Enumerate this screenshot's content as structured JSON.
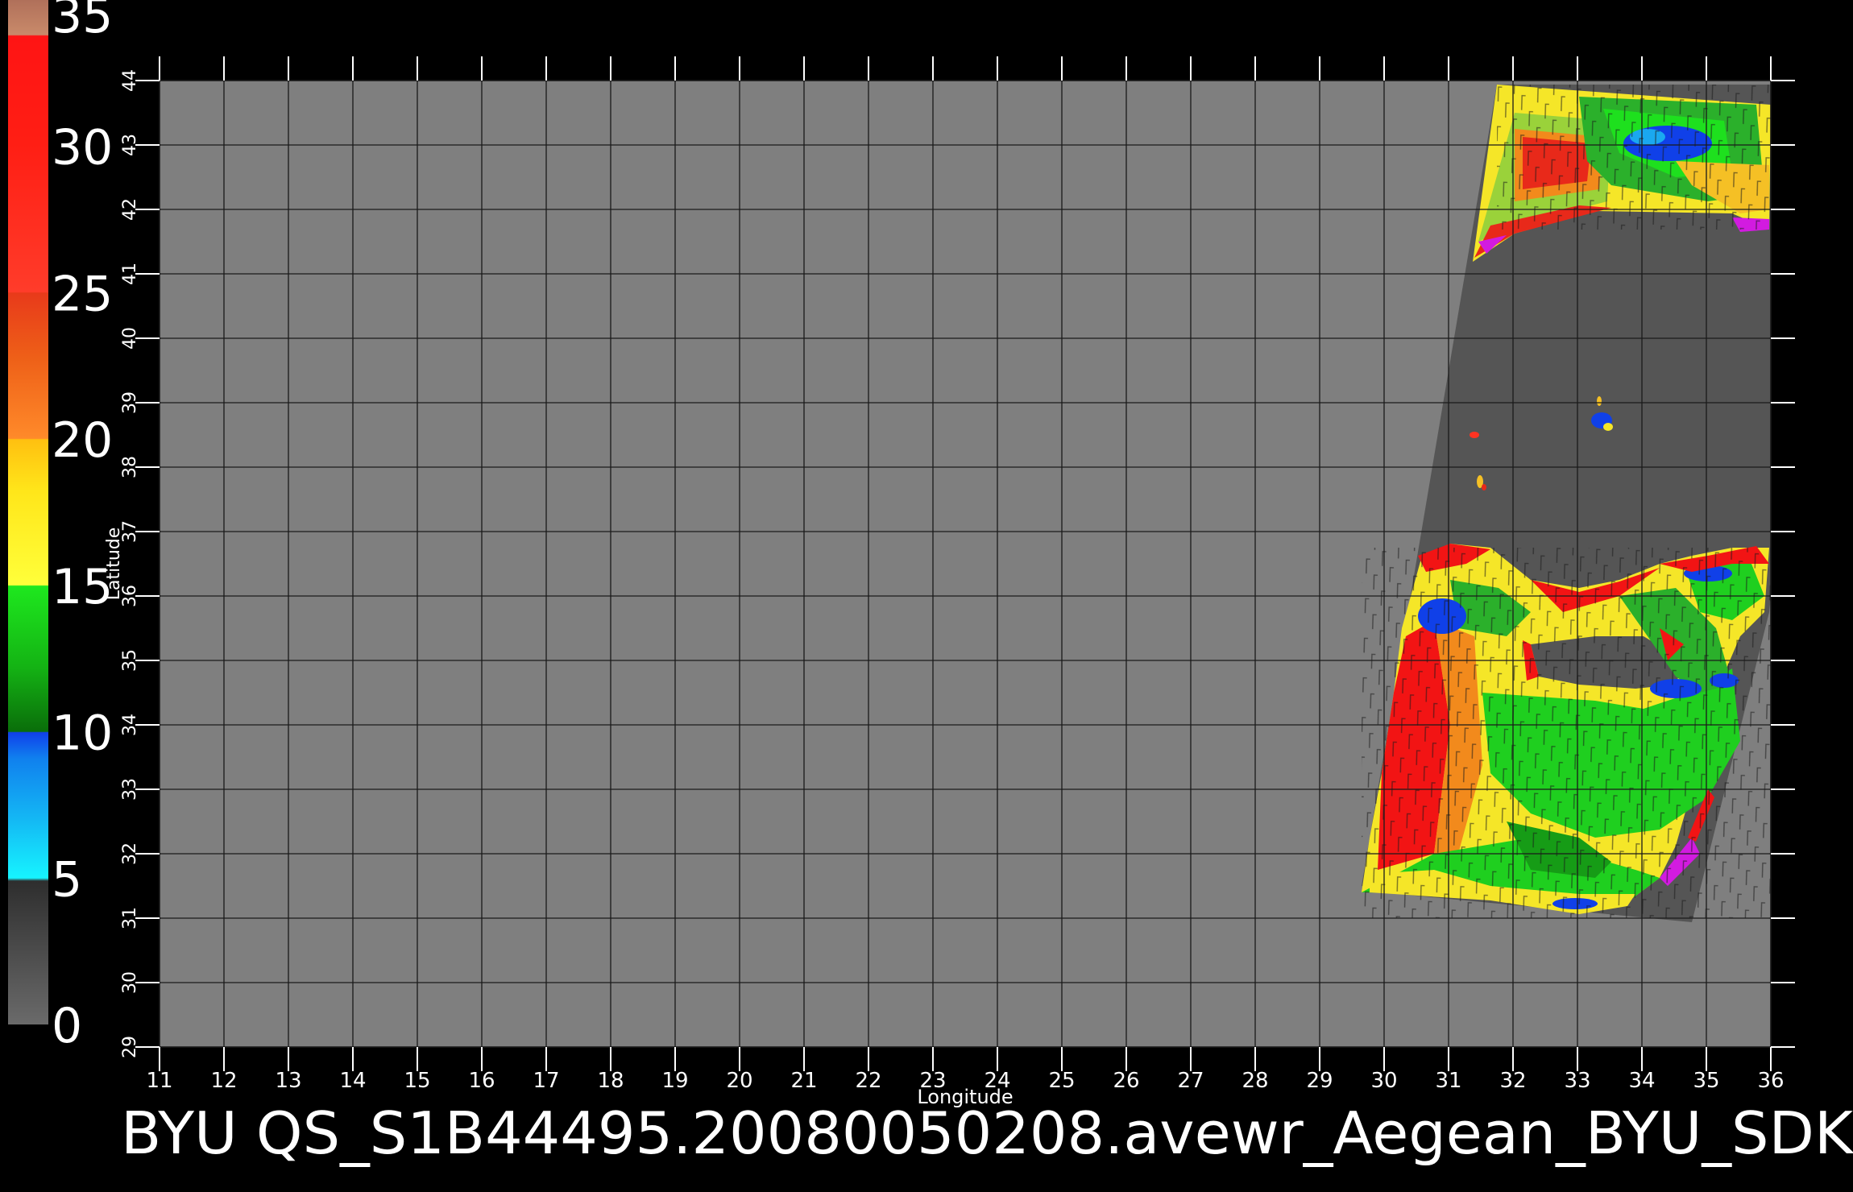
{
  "title": "BYU  QS_S1B44495.20080050208.avewr_Aegean_BYU_SDK",
  "axes": {
    "xlabel": "Longitude",
    "ylabel": "Latitude",
    "lon_range": [
      11,
      36
    ],
    "lat_range": [
      29,
      44
    ],
    "lon_ticks": [
      "11",
      "12",
      "13",
      "14",
      "15",
      "16",
      "17",
      "18",
      "19",
      "20",
      "21",
      "22",
      "23",
      "24",
      "25",
      "26",
      "27",
      "28",
      "29",
      "30",
      "31",
      "32",
      "33",
      "34",
      "35",
      "36"
    ],
    "lat_ticks": [
      "29",
      "30",
      "31",
      "32",
      "33",
      "34",
      "35",
      "36",
      "37",
      "38",
      "39",
      "40",
      "41",
      "42",
      "43",
      "44"
    ],
    "grid": true
  },
  "colorbar": {
    "range": [
      0,
      35
    ],
    "labels": [
      "0",
      "5",
      "10",
      "15",
      "20",
      "25",
      "30",
      "35"
    ],
    "placement": "left",
    "stops": [
      {
        "from": 0,
        "to": 5,
        "color": "#5e5e5e"
      },
      {
        "from": 5,
        "to": 10,
        "color": "#17e8f4"
      },
      {
        "from": 10,
        "to": 15,
        "color": "#1250ee"
      },
      {
        "from": 15,
        "to": 20,
        "color": "#18b418"
      },
      {
        "from": 20,
        "to": 25,
        "color": "#f9e61e"
      },
      {
        "from": 25,
        "to": 30,
        "color": "#ea5418"
      },
      {
        "from": 30,
        "to": 34,
        "color": "#f21414"
      },
      {
        "from": 34,
        "to": 35,
        "color": "#b87a5e"
      }
    ]
  },
  "colors": {
    "background": "#000000",
    "plot_area": "#7f7f7f",
    "swath_nodata": "#555555",
    "grid": "#1a1a1a",
    "text": "#ffffff"
  }
}
